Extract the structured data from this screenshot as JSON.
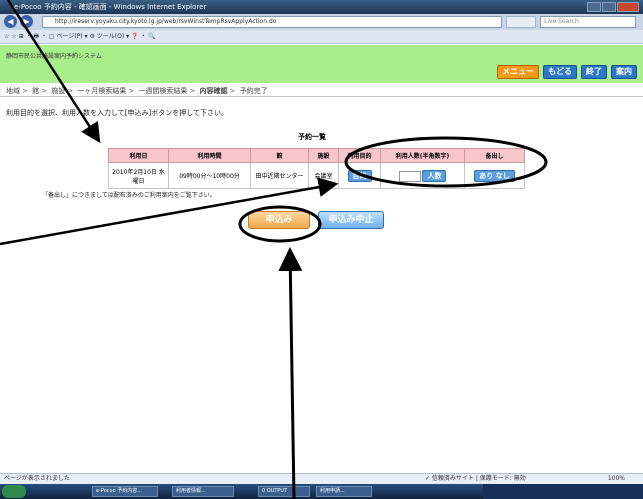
{
  "browser": {
    "title": "e-Pocoo 予約内容 - 確認画面 - Windows Internet Explorer",
    "url": "http://ireserv.yoyaku.city.kyoto.lg.jp/web/rsvWInstTempRsvApplyAction.do",
    "search_placeholder": "Live Search",
    "command_bar": "☆ ☆ ⊞ ・ 🖶 ・ ▢ ページ(P) ▾ ⚙ ツール(O) ▾ ❓ ・ 🔍"
  },
  "site": {
    "title": "静岡市民公共施設案内予約システム",
    "header_buttons": [
      {
        "label": "メニュー"
      },
      {
        "label": "もどる"
      },
      {
        "label": "終了"
      },
      {
        "label": "案内"
      }
    ]
  },
  "breadcrumb": [
    "地域",
    "館",
    "施設",
    "一ヶ月検索結果",
    "一週間検索結果",
    "内容確認",
    "予約完了"
  ],
  "instruction": "利用目的を選択、利用人数を入力して[申込み]ボタンを押して下さい。",
  "reservation_table": {
    "title": "予約一覧",
    "headers": [
      "利用日",
      "利用時間",
      "館",
      "施設",
      "利用目的",
      "利用人数(半角数字)",
      "备出し"
    ],
    "row": {
      "date": "2010年2月10日 水曜日",
      "time": "09時00分～10時00分",
      "building": "田中近隣センター",
      "facility": "会議室",
      "purpose_button": "目的",
      "count_button": "人数",
      "option_button": "あり なし"
    }
  },
  "note": "「备出し」につきましては配布済みのご利用案内をご覧下さい。",
  "buttons": {
    "apply": "申込み",
    "cancel": "申込み中止"
  },
  "statusbar": {
    "left": "ページが表示されました",
    "mid": "✓ 信頼済みサイト | 保護モード: 無効",
    "zoom": "100%"
  },
  "taskbar": {
    "tasks": [
      "e-Pocoo 予約内容...",
      "利用者情報...",
      "0 OUTPUT",
      "利用申請..."
    ]
  },
  "colors": {
    "header_green": "#a8ee8a",
    "menu_orange": "#f39a1a",
    "nav_blue": "#2c78c8",
    "table_header_pink": "#f6c6cc",
    "apply_orange": "#f3a54a",
    "cancel_blue": "#6fb0ec"
  }
}
